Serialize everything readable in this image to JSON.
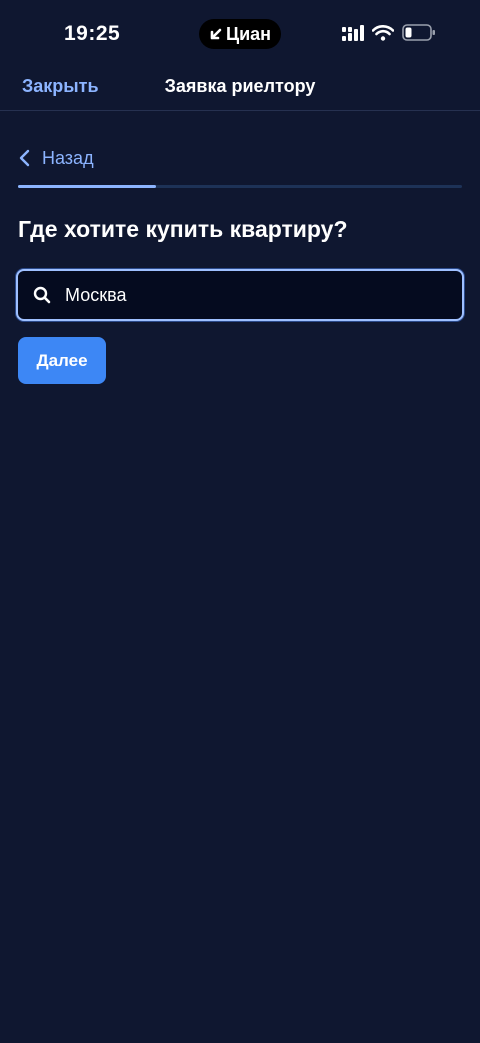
{
  "status_bar": {
    "time": "19:25",
    "back_app_label": "Циан"
  },
  "header": {
    "close_label": "Закрыть",
    "title": "Заявка риелтору"
  },
  "back": {
    "label": "Назад"
  },
  "progress": {
    "fraction": 0.31
  },
  "question": "Где хотите купить квартиру?",
  "search": {
    "value": "Москва",
    "placeholder": ""
  },
  "next_button_label": "Далее",
  "colors": {
    "background": "#0f1730",
    "accent": "#3d87f5",
    "link": "#8cb4ff"
  }
}
